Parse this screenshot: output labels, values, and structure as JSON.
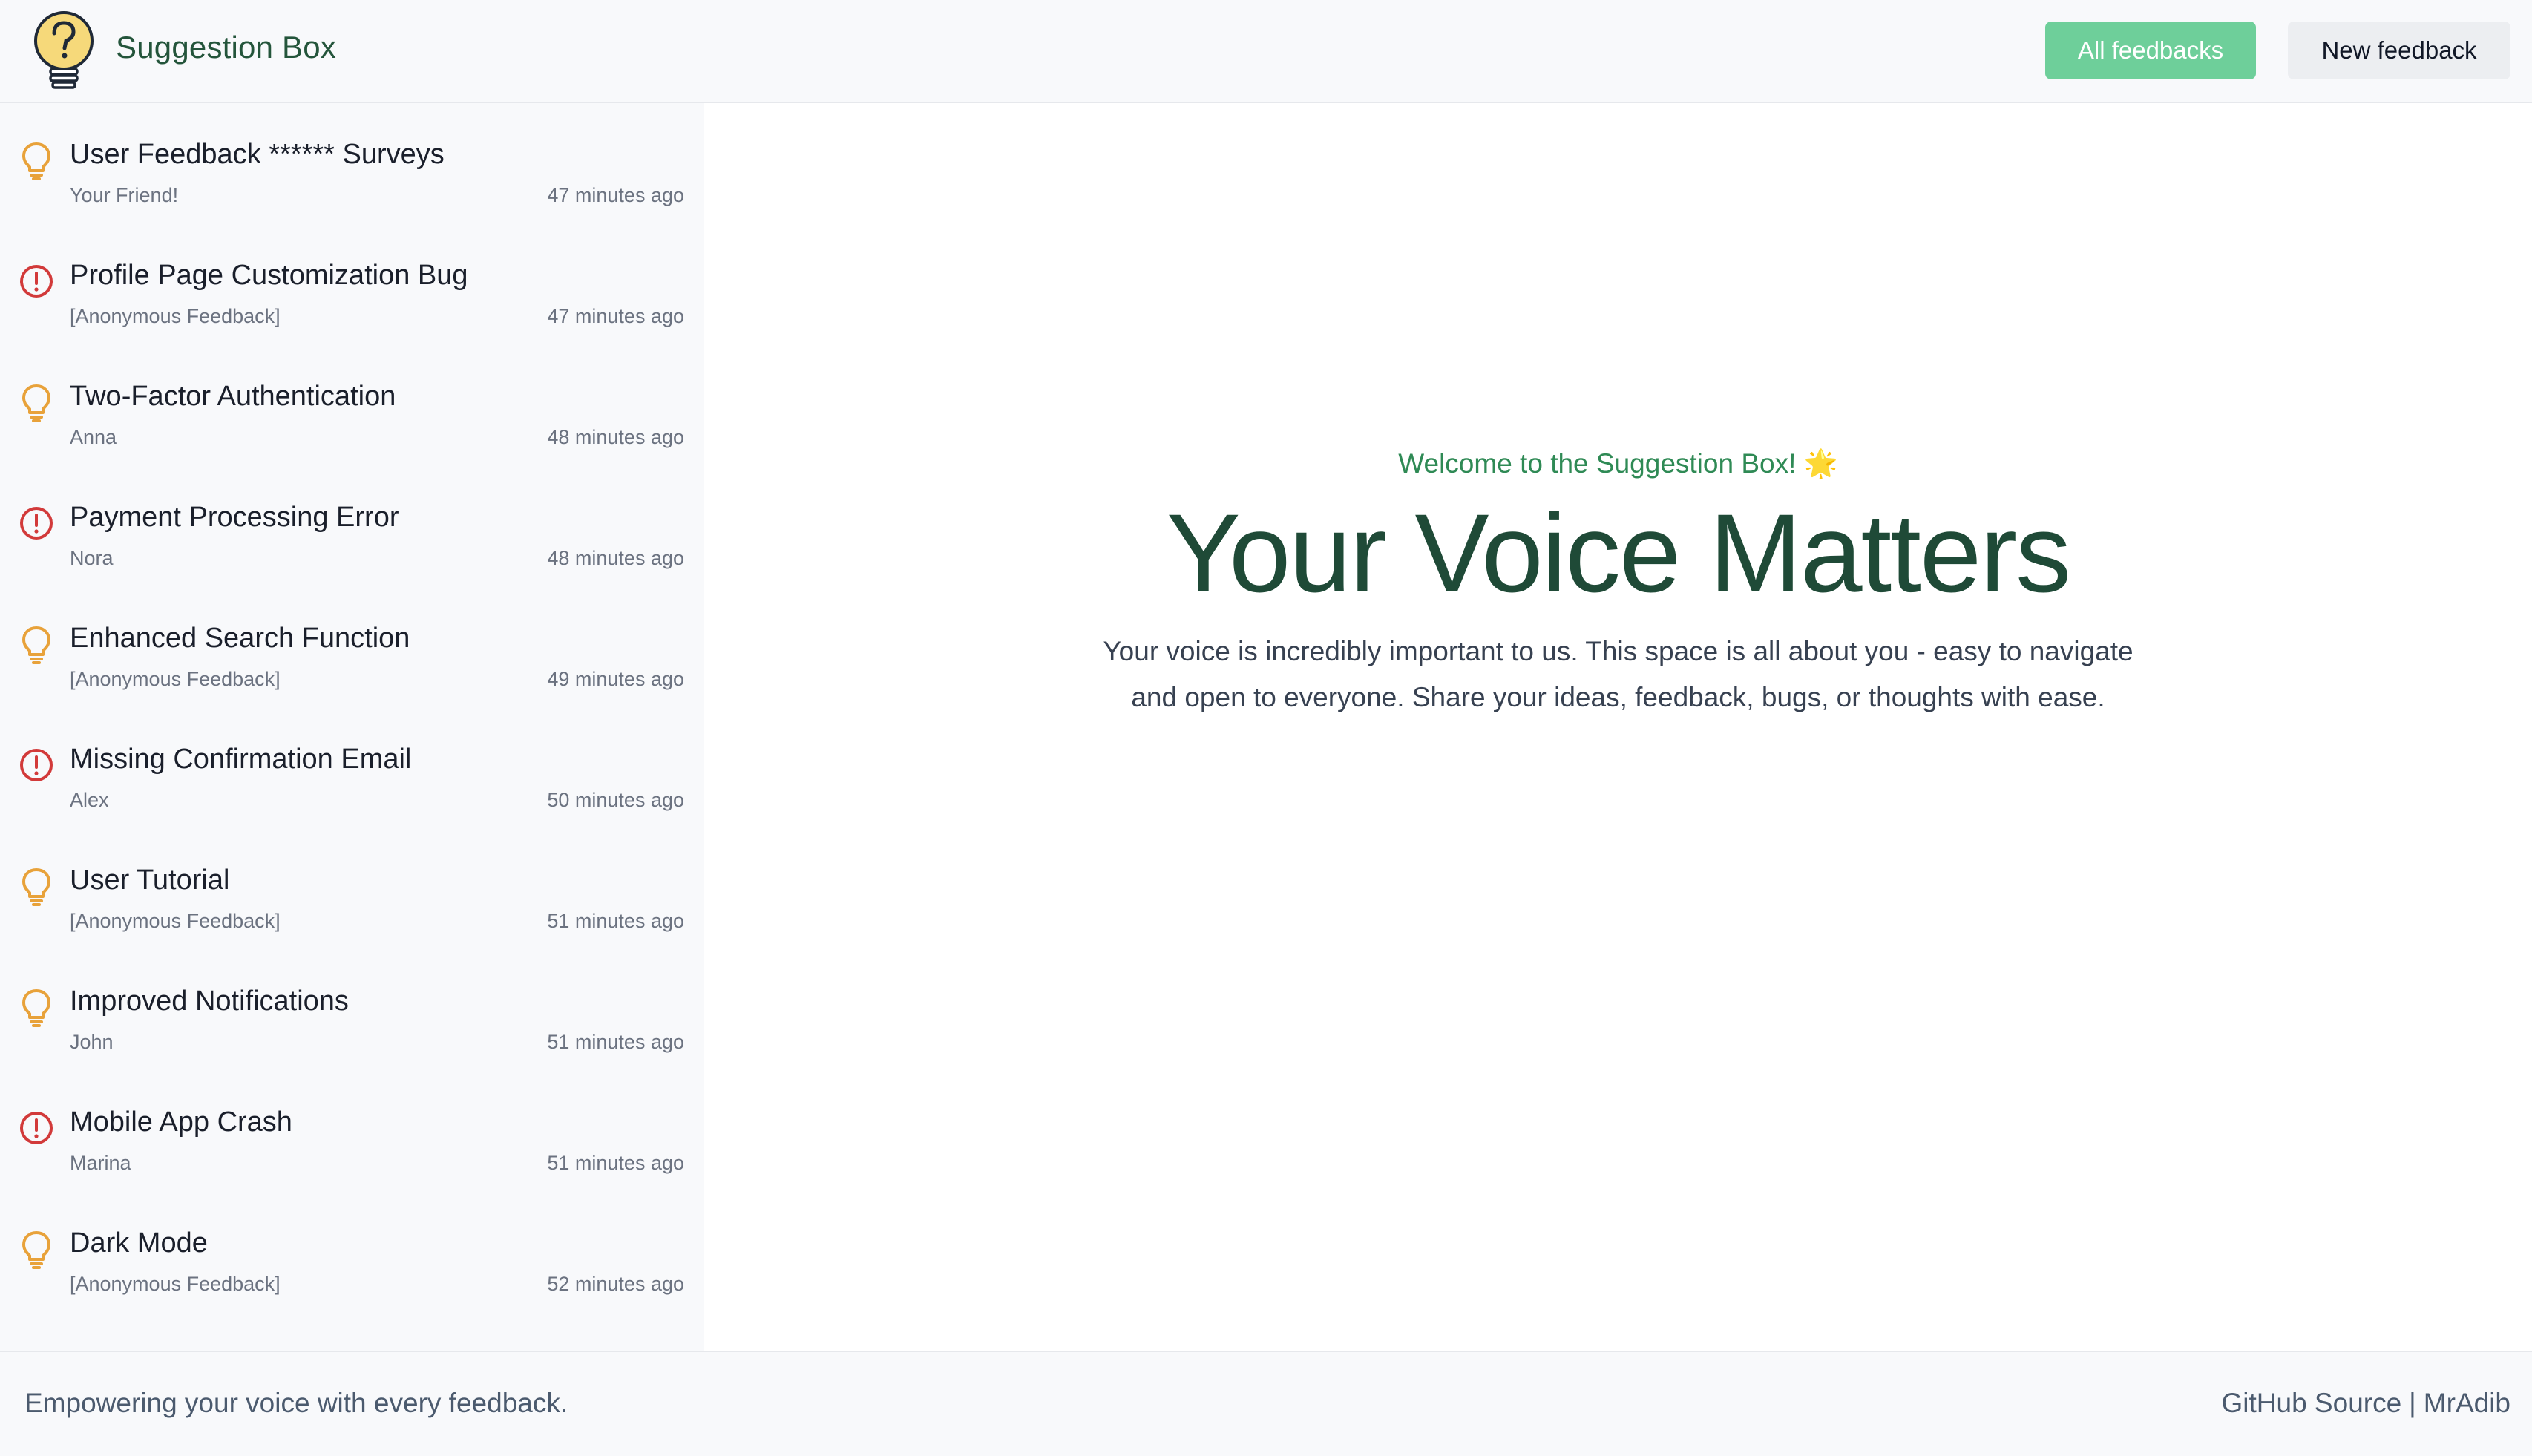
{
  "header": {
    "title": "Suggestion Box",
    "all_feedbacks_label": "All feedbacks",
    "new_feedback_label": "New feedback",
    "accent_color": "#6ecf9a"
  },
  "sidebar": {
    "items": [
      {
        "title": "User Feedback ****** Surveys",
        "author": "Your Friend!",
        "time": "47 minutes ago",
        "type": "suggestion",
        "icon": "lightbulb-icon"
      },
      {
        "title": "Profile Page Customization Bug",
        "author": "[Anonymous Feedback]",
        "time": "47 minutes ago",
        "type": "bug",
        "icon": "alert-circle-icon"
      },
      {
        "title": "Two-Factor Authentication",
        "author": "Anna",
        "time": "48 minutes ago",
        "type": "suggestion",
        "icon": "lightbulb-icon"
      },
      {
        "title": "Payment Processing Error",
        "author": "Nora",
        "time": "48 minutes ago",
        "type": "bug",
        "icon": "alert-circle-icon"
      },
      {
        "title": "Enhanced Search Function",
        "author": "[Anonymous Feedback]",
        "time": "49 minutes ago",
        "type": "suggestion",
        "icon": "lightbulb-icon"
      },
      {
        "title": "Missing Confirmation Email",
        "author": "Alex",
        "time": "50 minutes ago",
        "type": "bug",
        "icon": "alert-circle-icon"
      },
      {
        "title": "User Tutorial",
        "author": "[Anonymous Feedback]",
        "time": "51 minutes ago",
        "type": "suggestion",
        "icon": "lightbulb-icon"
      },
      {
        "title": "Improved Notifications",
        "author": "John",
        "time": "51 minutes ago",
        "type": "suggestion",
        "icon": "lightbulb-icon"
      },
      {
        "title": "Mobile App Crash",
        "author": "Marina",
        "time": "51 minutes ago",
        "type": "bug",
        "icon": "alert-circle-icon"
      },
      {
        "title": "Dark Mode",
        "author": "[Anonymous Feedback]",
        "time": "52 minutes ago",
        "type": "suggestion",
        "icon": "lightbulb-icon"
      }
    ],
    "suggestion_color": "#e8a23a",
    "bug_color": "#d23a3a"
  },
  "main": {
    "welcome": "Welcome to the Suggestion Box! 🌟",
    "hero": "Your Voice Matters",
    "description": "Your voice is incredibly important to us. This space is all about you - easy to navigate and open to everyone. Share your ideas, feedback, bugs, or thoughts with ease."
  },
  "footer": {
    "tagline": "Empowering your voice with every feedback.",
    "github_label": "GitHub Source",
    "separator": "|",
    "author_label": "MrAdib"
  }
}
